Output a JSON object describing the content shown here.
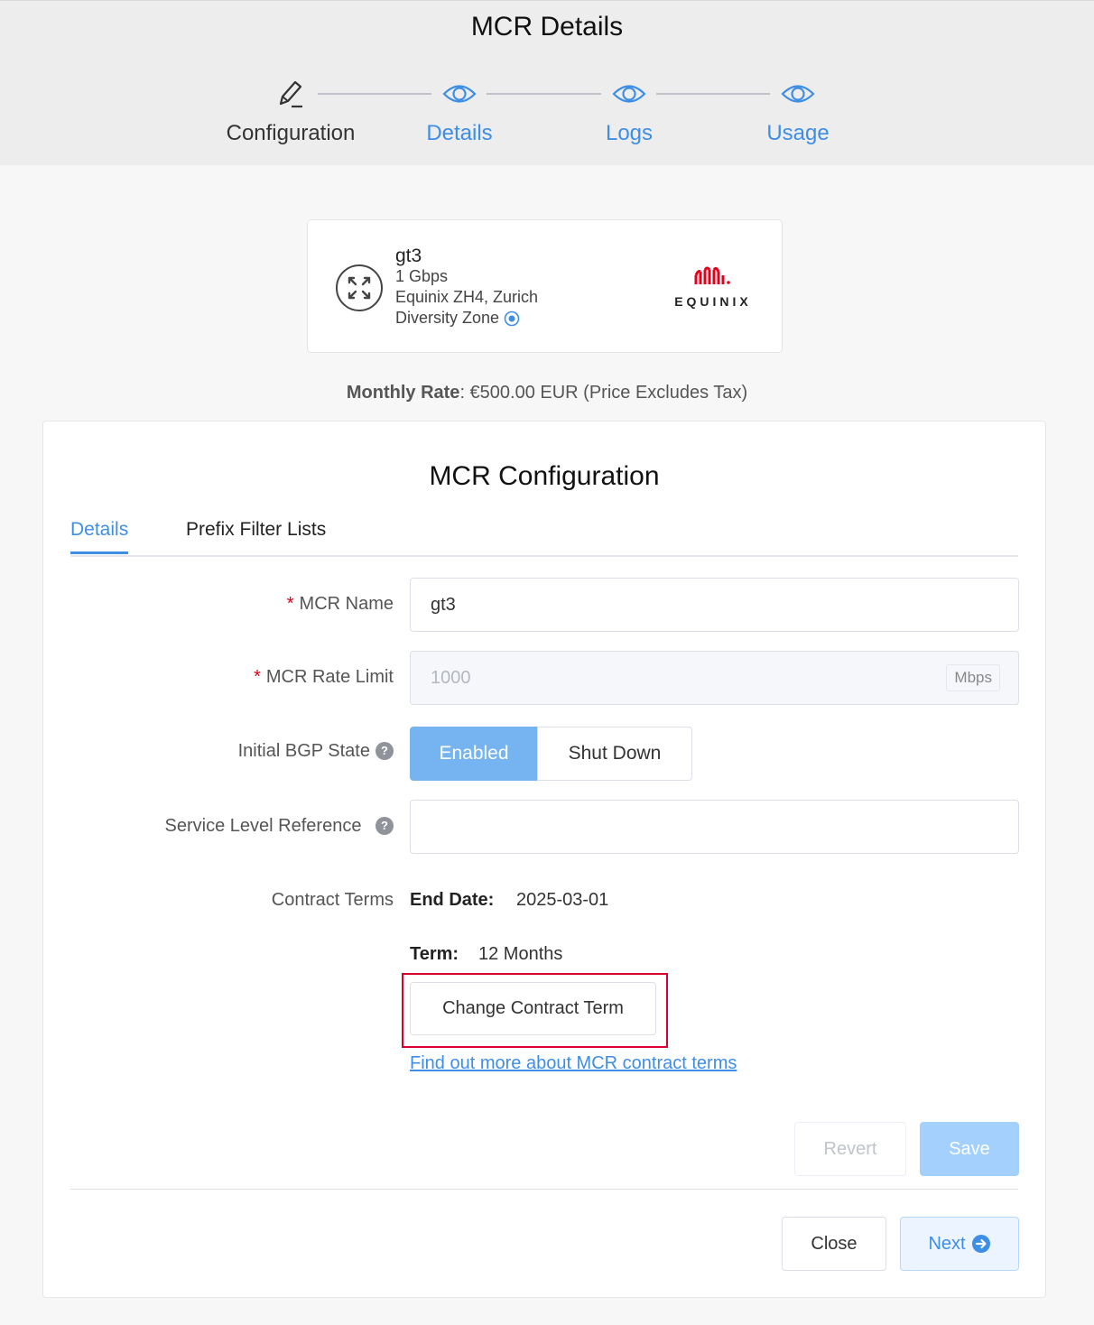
{
  "header": {
    "title": "MCR Details",
    "steps": [
      {
        "label": "Configuration",
        "icon": "pencil-icon",
        "state": "active"
      },
      {
        "label": "Details",
        "icon": "eye-icon",
        "state": "link"
      },
      {
        "label": "Logs",
        "icon": "eye-icon",
        "state": "link"
      },
      {
        "label": "Usage",
        "icon": "eye-icon",
        "state": "link"
      }
    ]
  },
  "card": {
    "name": "gt3",
    "speed": "1 Gbps",
    "location": "Equinix ZH4, Zurich",
    "diversity_zone": "Diversity Zone",
    "provider_logo": "EQUINIX"
  },
  "rate": {
    "label": "Monthly Rate",
    "value": ": €500.00 EUR (Price Excludes Tax)"
  },
  "panel": {
    "title": "MCR Configuration",
    "tabs": [
      {
        "label": "Details",
        "active": true
      },
      {
        "label": "Prefix Filter Lists",
        "active": false
      }
    ]
  },
  "form": {
    "name_label": "MCR Name",
    "name_value": "gt3",
    "rate_label": "MCR Rate Limit",
    "rate_value": "1000",
    "rate_unit": "Mbps",
    "bgp_label": "Initial BGP State",
    "bgp_options": [
      "Enabled",
      "Shut Down"
    ],
    "bgp_selected": "Enabled",
    "slr_label": "Service Level Reference",
    "slr_value": "",
    "contract_label": "Contract Terms",
    "end_date_key": "End Date:",
    "end_date_value": "2025-03-01",
    "term_key": "Term:",
    "term_value": "12 Months",
    "change_term_button": "Change Contract Term",
    "learn_more_link": "Find out more about MCR contract terms"
  },
  "actions": {
    "revert": "Revert",
    "save": "Save",
    "close": "Close",
    "next": "Next"
  },
  "colors": {
    "accent": "#3e8ee6",
    "enabled_bg": "#75b4f0",
    "highlight": "#d9002d",
    "equinix_red": "#e2011a"
  }
}
